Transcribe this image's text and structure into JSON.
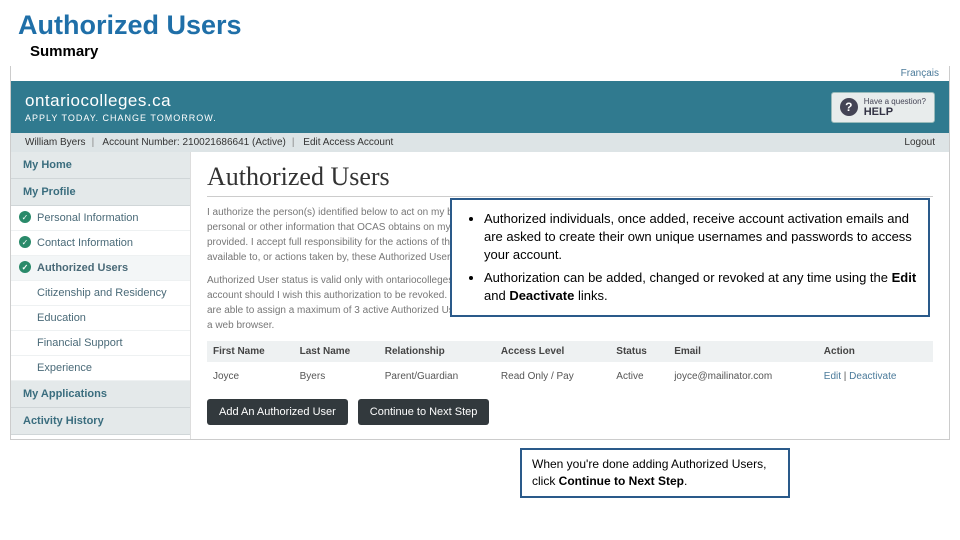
{
  "slide": {
    "title": "Authorized Users",
    "subtitle": "Summary"
  },
  "screenshot": {
    "lang_link": "Français",
    "brand": {
      "logo": "ontariocolleges.ca",
      "tagline": "APPLY TODAY. CHANGE TOMORROW."
    },
    "help": {
      "q": "?",
      "have": "Have a question?",
      "help": "HELP"
    },
    "acct": {
      "name": "William Byers",
      "number_lbl": "Account Number:",
      "number": "210021686641",
      "status": "(Active)",
      "edit": "Edit Access Account",
      "logout": "Logout"
    },
    "sidebar": {
      "home": "My Home",
      "profile": "My Profile",
      "items": [
        {
          "label": "Personal Information",
          "check": true
        },
        {
          "label": "Contact Information",
          "check": true
        },
        {
          "label": "Authorized Users",
          "check": true,
          "active": true
        },
        {
          "label": "Citizenship and Residency"
        },
        {
          "label": "Education"
        },
        {
          "label": "Financial Support"
        },
        {
          "label": "Experience"
        }
      ],
      "apps": "My Applications",
      "activity": "Activity History"
    },
    "content": {
      "title": "Authorized Users",
      "p1": "I authorize the person(s) identified below to act on my behalf with ontariocolleges.ca and OCAS. I may choose to grant 'Full' access or 'Read Only' access to my personal or other information that OCAS obtains on my behalf for my application and I accept full responsibility for the accuracy and integrity of the information provided. I accept full responsibility for the actions of the Authorized person(s). I release OCAS and its partners from any liability resulting from information made available to, or actions taken by, these Authorized Users.",
      "p2": "Authorized User status is valid only with ontariocolleges.ca; permission is not extended to the colleges. I must advise ontariocolleges.ca through the secure online account should I wish this authorization to be revoked. The authorization expires at the end of the application cycle for which the user was authorized. Applicants are able to assign a maximum of 3 active Authorized Users. An Authorized User can only access their account by logging into the ontariocolleges.ca online portal in a web browser.",
      "table": {
        "headers": [
          "First Name",
          "Last Name",
          "Relationship",
          "Access Level",
          "Status",
          "Email",
          "Action"
        ],
        "row": {
          "first": "Joyce",
          "last": "Byers",
          "rel": "Parent/Guardian",
          "level": "Read Only / Pay",
          "status": "Active",
          "email": "joyce@mailinator.com",
          "edit": "Edit",
          "sep": " | ",
          "deact": "Deactivate"
        }
      },
      "buttons": {
        "add": "Add An Authorized User",
        "cont": "Continue to Next Step"
      }
    }
  },
  "callouts": {
    "b1": "Authorized individuals, once added, receive account activation  emails and are asked to create their own unique usernames and  passwords to access your account.",
    "b2a": "Authorization can be added, changed or revoked at any time  using the ",
    "b2b": "Edit",
    "b2c": " and ",
    "b2d": "Deactivate",
    "b2e": " links.",
    "tip1": "When you're done adding Authorized  Users, click ",
    "tip2": "Continue to Next Step",
    "tip3": "."
  }
}
